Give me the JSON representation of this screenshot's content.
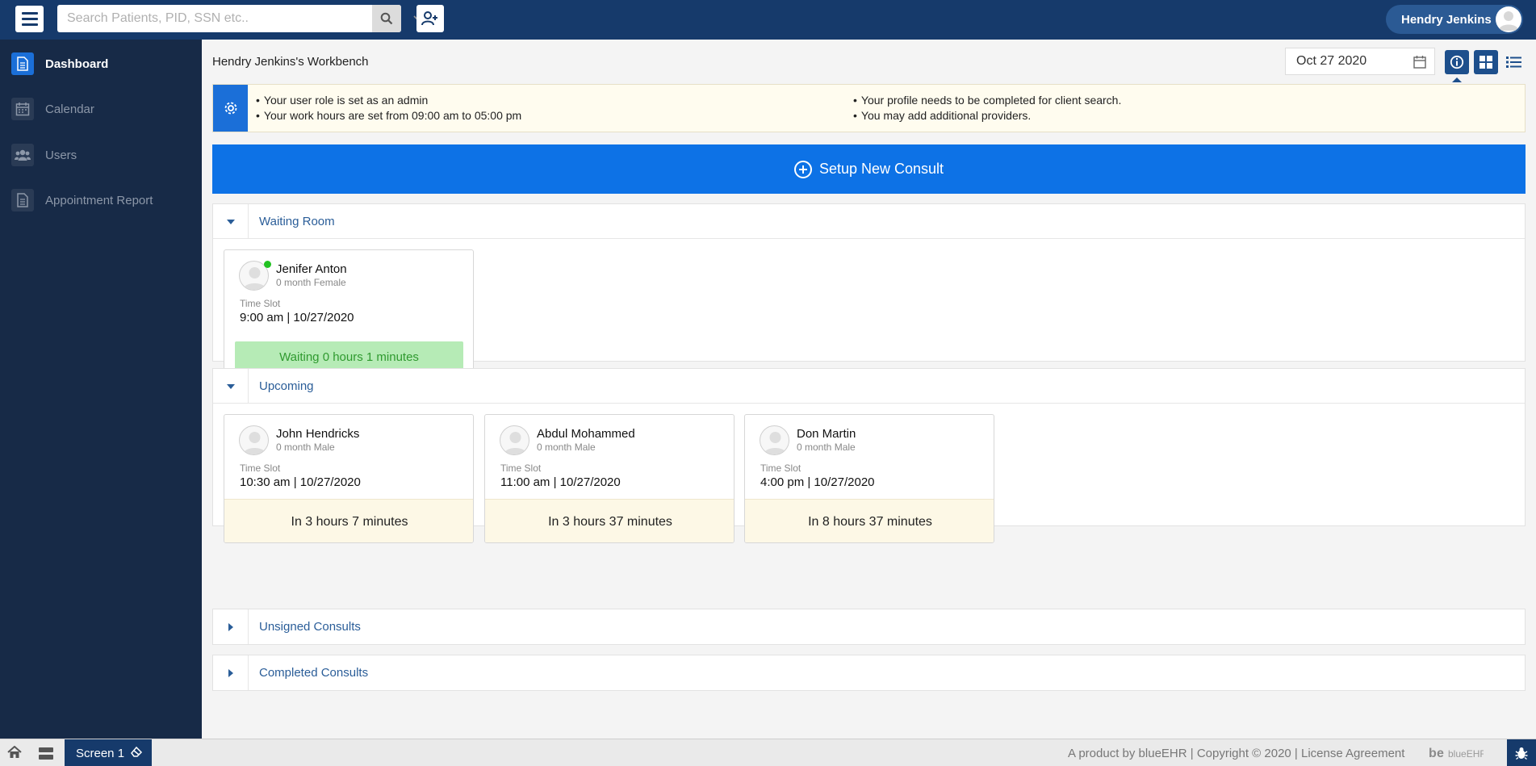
{
  "topbar": {
    "search_placeholder": "Search Patients, PID, SSN etc..",
    "user_name": "Hendry Jenkins"
  },
  "sidebar": {
    "items": [
      {
        "label": "Dashboard",
        "icon": "document-icon",
        "active": true
      },
      {
        "label": "Calendar",
        "icon": "calendar-icon",
        "active": false
      },
      {
        "label": "Users",
        "icon": "users-icon",
        "active": false
      },
      {
        "label": "Appointment Report",
        "icon": "report-icon",
        "active": false
      }
    ]
  },
  "main": {
    "title": "Hendry Jenkins's Workbench",
    "date": "Oct 27 2020",
    "banner": {
      "left": [
        "Your user role is set as an admin",
        "Your work hours are set from 09:00 am to 05:00 pm"
      ],
      "right": [
        "Your profile needs to be completed for client search.",
        "You may add additional providers."
      ]
    },
    "setup_label": "Setup New Consult",
    "sections": {
      "waiting": {
        "title": "Waiting Room",
        "cards": [
          {
            "name": "Jenifer Anton",
            "meta": "0 month Female",
            "slot_label": "Time Slot",
            "slot": "9:00 am | 10/27/2020",
            "status": "Waiting 0 hours 1 minutes",
            "online": true
          }
        ]
      },
      "upcoming": {
        "title": "Upcoming",
        "cards": [
          {
            "name": "John Hendricks",
            "meta": "0 month Male",
            "slot_label": "Time Slot",
            "slot": "10:30 am | 10/27/2020",
            "status": "In 3 hours 7 minutes"
          },
          {
            "name": "Abdul Mohammed",
            "meta": "0 month Male",
            "slot_label": "Time Slot",
            "slot": "11:00 am | 10/27/2020",
            "status": "In 3 hours 37 minutes"
          },
          {
            "name": "Don Martin",
            "meta": "0 month Male",
            "slot_label": "Time Slot",
            "slot": "4:00 pm | 10/27/2020",
            "status": "In 8 hours 37 minutes"
          }
        ]
      },
      "unsigned": {
        "title": "Unsigned Consults"
      },
      "completed": {
        "title": "Completed Consults"
      }
    }
  },
  "footer": {
    "tab_label": "Screen 1",
    "copyright": "A product by blueEHR | Copyright © 2020 | License Agreement",
    "logo_text": "blueEHR"
  },
  "colors": {
    "topbar": "#163a6b",
    "sidebar": "#172a47",
    "accent": "#0d72e6",
    "waiting_badge": "#b6ebb6",
    "upcoming_footer": "#fdf8e6"
  }
}
